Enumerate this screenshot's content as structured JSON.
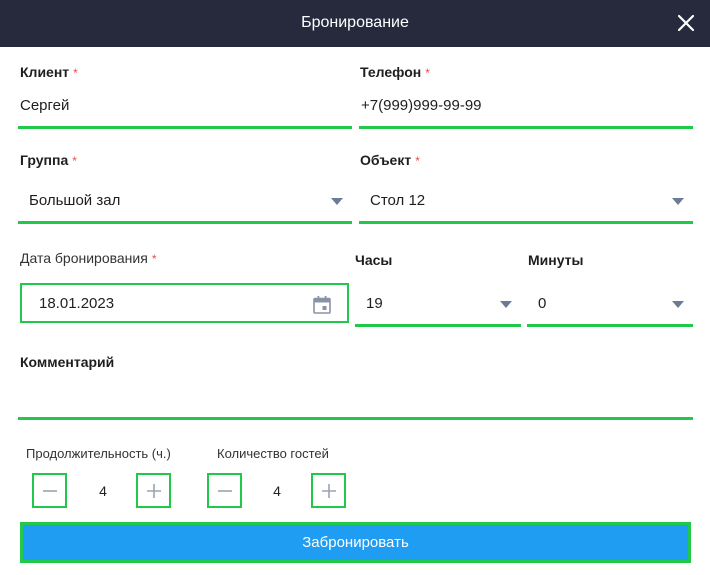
{
  "header": {
    "title": "Бронирование",
    "close_icon": "close-icon"
  },
  "client": {
    "label": "Клиент",
    "required": "*",
    "value": "Сергей"
  },
  "phone": {
    "label": "Телефон",
    "required": "*",
    "value": "+7(999)999-99-99"
  },
  "group": {
    "label": "Группа",
    "required": "*",
    "value": "Большой зал"
  },
  "object": {
    "label": "Объект",
    "required": "*",
    "value": "Стол 12"
  },
  "date": {
    "label": "Дата бронирования",
    "required": "*",
    "value": "18.01.2023",
    "icon": "calendar-icon"
  },
  "hours": {
    "label": "Часы",
    "value": "19"
  },
  "minutes": {
    "label": "Минуты",
    "value": "0"
  },
  "comment": {
    "label": "Комментарий",
    "value": ""
  },
  "duration": {
    "label": "Продолжительность (ч.)",
    "value": "4"
  },
  "guests": {
    "label": "Количество гостей",
    "value": "4"
  },
  "submit": {
    "label": "Забронировать"
  },
  "colors": {
    "header_bg": "#262a3c",
    "accent_green": "#22c84a",
    "button_blue": "#1e9df2",
    "required_red": "#e2504c"
  }
}
